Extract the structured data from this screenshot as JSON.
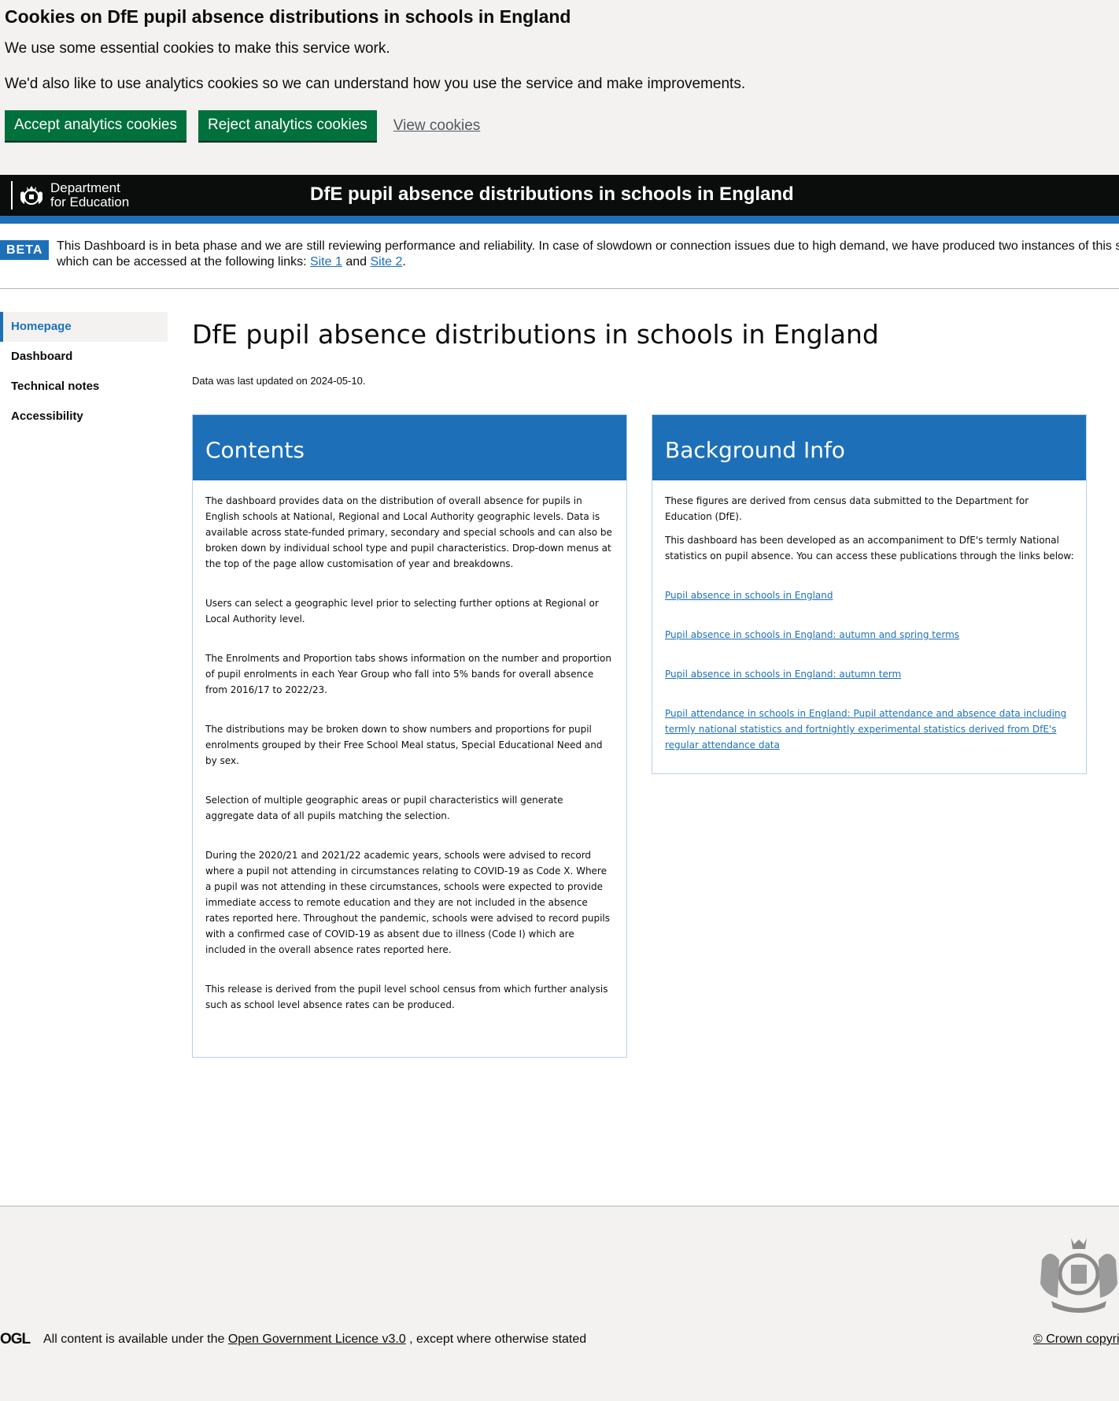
{
  "cookie_banner": {
    "title": "Cookies on DfE pupil absence distributions in schools in England",
    "line1": "We use some essential cookies to make this service work.",
    "line2": "We'd also like to use analytics cookies so we can understand how you use the service and make improvements.",
    "accept_label": "Accept analytics cookies",
    "reject_label": "Reject analytics cookies",
    "view_label": "View cookies"
  },
  "header": {
    "dept_line1": "Department",
    "dept_line2": "for Education",
    "title": "DfE pupil absence distributions in schools in England"
  },
  "beta": {
    "tag": "BETA",
    "text_line1": "This Dashboard is in beta phase and we are still reviewing performance and reliability. In case of slowdown or connection issues due to high demand, we have produced two instances of this s",
    "text_line2_prefix": "which can be accessed at the following links: ",
    "site1": "Site 1",
    "and": " and ",
    "site2": "Site 2",
    "suffix": "."
  },
  "sidebar": {
    "items": [
      {
        "label": "Homepage"
      },
      {
        "label": "Dashboard"
      },
      {
        "label": "Technical notes"
      },
      {
        "label": "Accessibility"
      }
    ]
  },
  "main": {
    "title": "DfE pupil absence distributions in schools in England",
    "updated": "Data was last updated on 2024-05-10."
  },
  "contents": {
    "heading": "Contents",
    "paragraphs": [
      "The dashboard provides data on the distribution of overall absence for pupils in English schools at National, Regional and Local Authority geographic levels. Data is available across state-funded primary, secondary and special schools and can also be broken down by individual school type and pupil characteristics. Drop-down menus at the top of the page allow customisation of year and breakdowns.",
      "Users can select a geographic level prior to selecting further options at Regional or Local Authority level.",
      "The Enrolments and Proportion tabs shows information on the number and proportion of pupil enrolments in each Year Group who fall into 5% bands for overall absence from 2016/17 to 2022/23.",
      "The distributions may be broken down to show numbers and proportions for pupil enrolments grouped by their Free School Meal status, Special Educational Need and by sex.",
      "Selection of multiple geographic areas or pupil characteristics will generate aggregate data of all pupils matching the selection.",
      "During the 2020/21 and 2021/22 academic years, schools were advised to record where a pupil not attending in circumstances relating to COVID-19 as Code X. Where a pupil was not attending in these circumstances, schools were expected to provide immediate access to remote education and they are not included in the absence rates reported here. Throughout the pandemic, schools were advised to record pupils with a confirmed case of COVID-19 as absent due to illness (Code I) which are included in the overall absence rates reported here.",
      "This release is derived from the pupil level school census from which further analysis such as school level absence rates can be produced."
    ]
  },
  "background": {
    "heading": "Background Info",
    "p1": "These figures are derived from census data submitted to the Department for Education (DfE).",
    "p2": "This dashboard has been developed as an accompaniment to DfE's termly National statistics on pupil absence. You can access these publications through the links below:",
    "links": [
      "Pupil absence in schools in England",
      "Pupil absence in schools in England: autumn and spring terms",
      "Pupil absence in schools in England: autumn term",
      "Pupil attendance in schools in England: Pupil attendance and absence data including termly national statistics and fortnightly experimental statistics derived from DfE's regular attendance data"
    ]
  },
  "footer": {
    "ogl": "OGL",
    "text_prefix": "All content is available under the ",
    "licence_link": "Open Government Licence v3.0",
    "text_suffix": " , except where otherwise stated",
    "crown": "© Crown copyri"
  }
}
